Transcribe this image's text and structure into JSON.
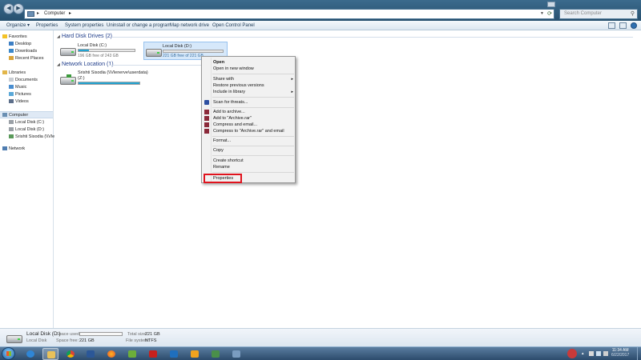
{
  "address_bar": {
    "crumb": "Computer",
    "search_placeholder": "Search Computer"
  },
  "toolbar": {
    "organize": "Organize ▾",
    "properties": "Properties",
    "system_properties": "System properties",
    "uninstall": "Uninstall or change a program",
    "map_drive": "Map network drive",
    "control_panel": "Open Control Panel"
  },
  "nav": {
    "favorites": "Favorites",
    "desktop": "Desktop",
    "downloads": "Downloads",
    "recent": "Recent Places",
    "libraries": "Libraries",
    "documents": "Documents",
    "music": "Music",
    "pictures": "Pictures",
    "videos": "Videos",
    "computer": "Computer",
    "disk_c": "Local Disk (C:)",
    "disk_d": "Local Disk (D:)",
    "net_share": "Srishti Sisodia (\\\\Vle",
    "network": "Network"
  },
  "groups": {
    "hdd": "Hard Disk Drives (2)",
    "netloc": "Network Location (1)"
  },
  "drives": [
    {
      "name": "Local Disk (C:)",
      "free": "196 GB free of 243 GB",
      "used_fraction": 0.19
    },
    {
      "name": "Local Disk (D:)",
      "free": "221 GB free of 221 GB",
      "used_fraction": 0.0
    },
    {
      "name": "Srishti Sisodia (\\\\Vlenerve\\userdata)",
      "name2": "(Z:)",
      "free": "",
      "used_fraction": 1.0
    }
  ],
  "context_menu": {
    "open": "Open",
    "open_new": "Open in new window",
    "share": "Share with",
    "restore": "Restore previous versions",
    "include": "Include in library",
    "scan": "Scan for threats...",
    "add_archive": "Add to archive...",
    "add_rar": "Add to \"Archive.rar\"",
    "compress_email": "Compress and email...",
    "compress_rar_email": "Compress to \"Archive.rar\" and email",
    "format": "Format...",
    "copy": "Copy",
    "create_shortcut": "Create shortcut",
    "rename": "Rename",
    "properties": "Properties",
    "submenu_arrow": "▸"
  },
  "details": {
    "name": "Local Disk (D:)",
    "type": "Local Disk",
    "space_used_label": "Space used:",
    "space_free_label": "Space free:",
    "space_free": "221 GB",
    "total_size_label": "Total size:",
    "total_size": "221 GB",
    "fs_label": "File system:",
    "fs": "NTFS"
  },
  "taskbar": {
    "time": "11:34 AM",
    "date": "6/22/2017"
  },
  "colors": {
    "accent": "#1e3c8a",
    "highlight_box": "#e0131e",
    "drive_fill": "#1a92c0"
  }
}
